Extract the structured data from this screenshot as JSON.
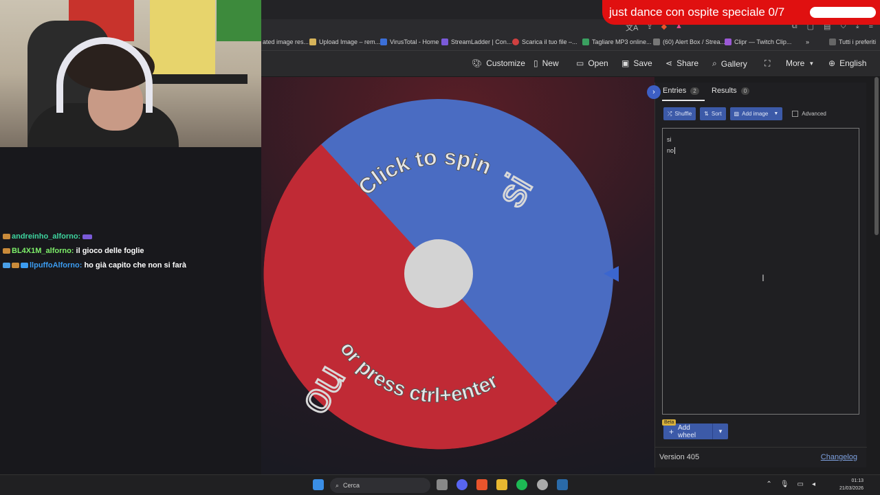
{
  "overlay": {
    "banner_text": "just dance con ospite speciale 0/7"
  },
  "bookmarks": [
    {
      "label": "ated image res...",
      "color": "#888888"
    },
    {
      "label": "Upload Image – rem...",
      "color": "#d6b35a"
    },
    {
      "label": "VirusTotal - Home",
      "color": "#3b6fd8"
    },
    {
      "label": "StreamLadder | Con...",
      "color": "#7a5ad8"
    },
    {
      "label": "Scarica il tuo file –...",
      "color": "#d04040"
    },
    {
      "label": "Tagliare MP3 online...",
      "color": "#3aa060"
    },
    {
      "label": "(60) Alert Box / Strea...",
      "color": "#777777"
    },
    {
      "label": "Clipr — Twitch Clip...",
      "color": "#9b59d6"
    },
    {
      "label": "Tutti i preferiti",
      "color": "#666666"
    }
  ],
  "toolbar": {
    "customize": "Customize",
    "new": "New",
    "open": "Open",
    "save": "Save",
    "share": "Share",
    "gallery": "Gallery",
    "more": "More",
    "language": "English"
  },
  "wheel": {
    "center_text_top": "Click to spin",
    "center_text_bottom": "or press ctrl+enter",
    "segments": [
      {
        "label": "si",
        "color": "#4a6cc2"
      },
      {
        "label": "no",
        "color": "#c02a35"
      }
    ]
  },
  "panel": {
    "tab_entries": "Entries",
    "entries_count": "2",
    "tab_results": "Results",
    "results_count": "0",
    "shuffle": "Shuffle",
    "sort": "Sort",
    "add_image": "Add image",
    "advanced": "Advanced",
    "entries": [
      "si",
      "no"
    ],
    "beta": "Beta",
    "add_wheel": "Add wheel",
    "version": "Version 405",
    "changelog": "Changelog"
  },
  "chat": [
    {
      "user": "andreinho_alforno:",
      "msg": "",
      "color": "#3ed6a0"
    },
    {
      "user": "BL4X1M_alforno:",
      "msg": "il gioco delle foglie",
      "color": "#7ef06a"
    },
    {
      "user": "llpuffoAlforno:",
      "msg": "ho già capito che non si farà",
      "color": "#3c9cf0"
    }
  ],
  "taskbar": {
    "search": "Cerca",
    "time": "01:13",
    "date": "21/03/2026"
  }
}
